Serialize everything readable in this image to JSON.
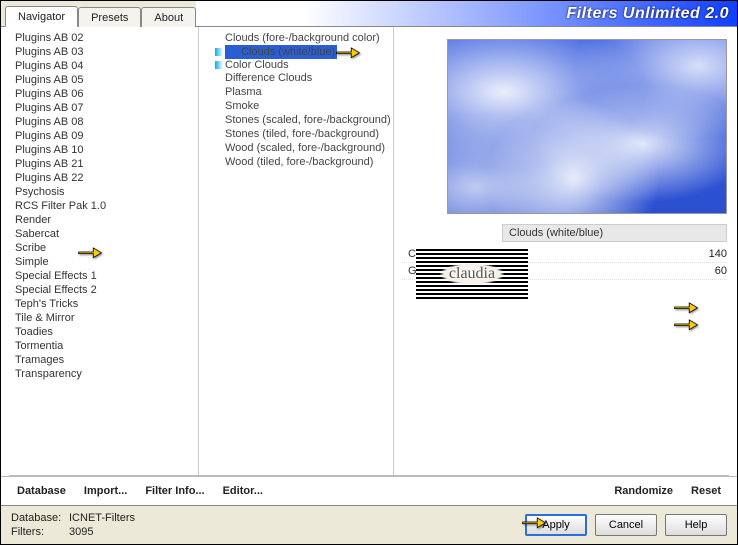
{
  "title": "Filters Unlimited 2.0",
  "tabs": [
    "Navigator",
    "Presets",
    "About"
  ],
  "active_tab": 0,
  "plugin_list": [
    "Plugins AB 02",
    "Plugins AB 03",
    "Plugins AB 04",
    "Plugins AB 05",
    "Plugins AB 06",
    "Plugins AB 07",
    "Plugins AB 08",
    "Plugins AB 09",
    "Plugins AB 10",
    "Plugins AB 21",
    "Plugins AB 22",
    "Psychosis",
    "RCS Filter Pak 1.0",
    "Render",
    "Sabercat",
    "Scribe",
    "Simple",
    "Special Effects 1",
    "Special Effects 2",
    "Teph's Tricks",
    "Tile & Mirror",
    "Toadies",
    "Tormentia",
    "Tramages",
    "Transparency"
  ],
  "plugin_selected_index": 13,
  "filter_list": [
    "Clouds (fore-/background color)",
    "Clouds (white/blue)",
    "Color Clouds",
    "Difference Clouds",
    "Plasma",
    "Smoke",
    "Stones (scaled, fore-/background)",
    "Stones (tiled, fore-/background)",
    "Wood (scaled, fore-/background)",
    "Wood (tiled, fore-/background)"
  ],
  "filter_selected_index": 1,
  "param_title": "Clouds (white/blue)",
  "params": [
    {
      "label": "Cloud Type",
      "value": 140
    },
    {
      "label": "Gamma",
      "value": 60
    }
  ],
  "watermark_text": "claudia",
  "toolbar": {
    "database": "Database",
    "import": "Import...",
    "filter_info": "Filter Info...",
    "editor": "Editor...",
    "randomize": "Randomize",
    "reset": "Reset"
  },
  "status": {
    "db_label": "Database:",
    "db_value": "ICNET-Filters",
    "filters_label": "Filters:",
    "filters_value": "3095"
  },
  "buttons": {
    "apply": "Apply",
    "cancel": "Cancel",
    "help": "Help"
  }
}
